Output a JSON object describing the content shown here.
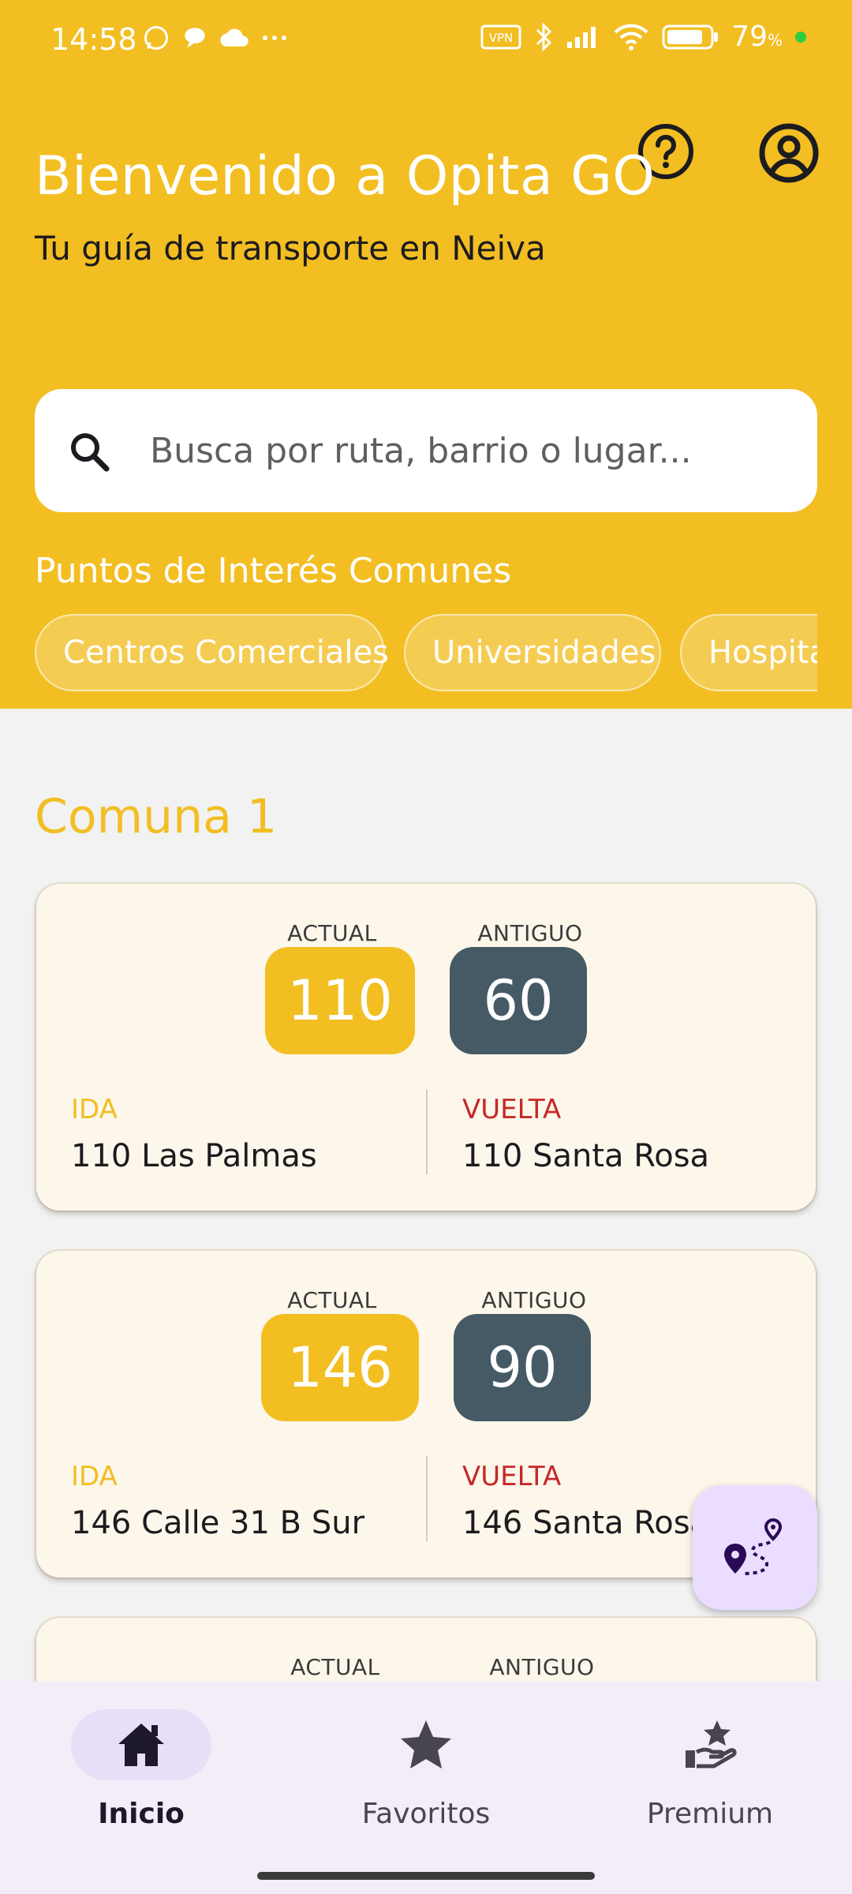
{
  "status_bar": {
    "time": "14:58",
    "battery_pct": "79",
    "battery_unit": "%"
  },
  "header": {
    "title": "Bienvenido a Opita GO",
    "subtitle": "Tu guía de transporte en Neiva"
  },
  "search": {
    "placeholder": "Busca por ruta, barrio o lugar..."
  },
  "poi": {
    "title": "Puntos de Interés Comunes",
    "chips": [
      "Centros Comerciales",
      "Universidades",
      "Hospitales"
    ]
  },
  "section": {
    "title": "Comuna 1"
  },
  "routes": [
    {
      "current_label": "ACTUAL",
      "current": "110",
      "old_label": "ANTIGUO",
      "old": "60",
      "ida_label": "IDA",
      "ida": "110 Las Palmas",
      "vuelta_label": "VUELTA",
      "vuelta": "110 Santa Rosa"
    },
    {
      "current_label": "ACTUAL",
      "current": "146",
      "old_label": "ANTIGUO",
      "old": "90",
      "ida_label": "IDA",
      "ida": "146 Calle 31 B Sur",
      "vuelta_label": "VUELTA",
      "vuelta": "146 Santa Rosa"
    },
    {
      "current_label": "ACTUAL",
      "old_label": "ANTIGUO"
    }
  ],
  "bottom_nav": [
    {
      "label": "Inicio",
      "icon": "home-icon",
      "active": true
    },
    {
      "label": "Favoritos",
      "icon": "star-icon",
      "active": false
    },
    {
      "label": "Premium",
      "icon": "premium-icon",
      "active": false
    }
  ],
  "colors": {
    "primary": "#F2BE22",
    "old_route": "#455A64",
    "vuelta": "#C62828",
    "nav_bg": "#F3EDF7",
    "fab_bg": "#EADDFF"
  }
}
